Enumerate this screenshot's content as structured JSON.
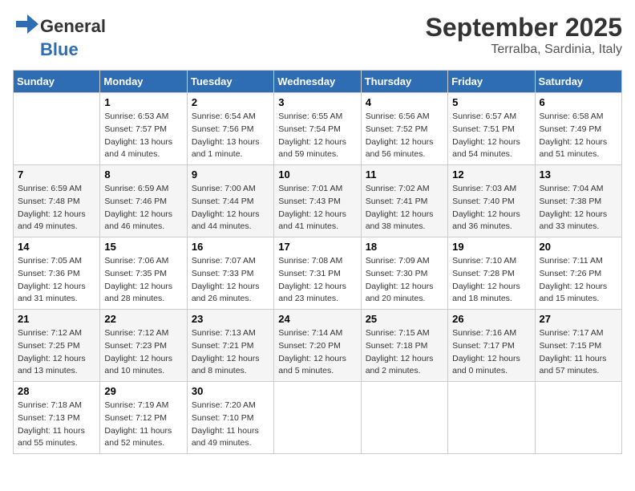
{
  "header": {
    "logo_general": "General",
    "logo_blue": "Blue",
    "month": "September 2025",
    "location": "Terralba, Sardinia, Italy"
  },
  "days_of_week": [
    "Sunday",
    "Monday",
    "Tuesday",
    "Wednesday",
    "Thursday",
    "Friday",
    "Saturday"
  ],
  "weeks": [
    [
      {
        "day": "",
        "sunrise": "",
        "sunset": "",
        "daylight": ""
      },
      {
        "day": "1",
        "sunrise": "Sunrise: 6:53 AM",
        "sunset": "Sunset: 7:57 PM",
        "daylight": "Daylight: 13 hours and 4 minutes."
      },
      {
        "day": "2",
        "sunrise": "Sunrise: 6:54 AM",
        "sunset": "Sunset: 7:56 PM",
        "daylight": "Daylight: 13 hours and 1 minute."
      },
      {
        "day": "3",
        "sunrise": "Sunrise: 6:55 AM",
        "sunset": "Sunset: 7:54 PM",
        "daylight": "Daylight: 12 hours and 59 minutes."
      },
      {
        "day": "4",
        "sunrise": "Sunrise: 6:56 AM",
        "sunset": "Sunset: 7:52 PM",
        "daylight": "Daylight: 12 hours and 56 minutes."
      },
      {
        "day": "5",
        "sunrise": "Sunrise: 6:57 AM",
        "sunset": "Sunset: 7:51 PM",
        "daylight": "Daylight: 12 hours and 54 minutes."
      },
      {
        "day": "6",
        "sunrise": "Sunrise: 6:58 AM",
        "sunset": "Sunset: 7:49 PM",
        "daylight": "Daylight: 12 hours and 51 minutes."
      }
    ],
    [
      {
        "day": "7",
        "sunrise": "Sunrise: 6:59 AM",
        "sunset": "Sunset: 7:48 PM",
        "daylight": "Daylight: 12 hours and 49 minutes."
      },
      {
        "day": "8",
        "sunrise": "Sunrise: 6:59 AM",
        "sunset": "Sunset: 7:46 PM",
        "daylight": "Daylight: 12 hours and 46 minutes."
      },
      {
        "day": "9",
        "sunrise": "Sunrise: 7:00 AM",
        "sunset": "Sunset: 7:44 PM",
        "daylight": "Daylight: 12 hours and 44 minutes."
      },
      {
        "day": "10",
        "sunrise": "Sunrise: 7:01 AM",
        "sunset": "Sunset: 7:43 PM",
        "daylight": "Daylight: 12 hours and 41 minutes."
      },
      {
        "day": "11",
        "sunrise": "Sunrise: 7:02 AM",
        "sunset": "Sunset: 7:41 PM",
        "daylight": "Daylight: 12 hours and 38 minutes."
      },
      {
        "day": "12",
        "sunrise": "Sunrise: 7:03 AM",
        "sunset": "Sunset: 7:40 PM",
        "daylight": "Daylight: 12 hours and 36 minutes."
      },
      {
        "day": "13",
        "sunrise": "Sunrise: 7:04 AM",
        "sunset": "Sunset: 7:38 PM",
        "daylight": "Daylight: 12 hours and 33 minutes."
      }
    ],
    [
      {
        "day": "14",
        "sunrise": "Sunrise: 7:05 AM",
        "sunset": "Sunset: 7:36 PM",
        "daylight": "Daylight: 12 hours and 31 minutes."
      },
      {
        "day": "15",
        "sunrise": "Sunrise: 7:06 AM",
        "sunset": "Sunset: 7:35 PM",
        "daylight": "Daylight: 12 hours and 28 minutes."
      },
      {
        "day": "16",
        "sunrise": "Sunrise: 7:07 AM",
        "sunset": "Sunset: 7:33 PM",
        "daylight": "Daylight: 12 hours and 26 minutes."
      },
      {
        "day": "17",
        "sunrise": "Sunrise: 7:08 AM",
        "sunset": "Sunset: 7:31 PM",
        "daylight": "Daylight: 12 hours and 23 minutes."
      },
      {
        "day": "18",
        "sunrise": "Sunrise: 7:09 AM",
        "sunset": "Sunset: 7:30 PM",
        "daylight": "Daylight: 12 hours and 20 minutes."
      },
      {
        "day": "19",
        "sunrise": "Sunrise: 7:10 AM",
        "sunset": "Sunset: 7:28 PM",
        "daylight": "Daylight: 12 hours and 18 minutes."
      },
      {
        "day": "20",
        "sunrise": "Sunrise: 7:11 AM",
        "sunset": "Sunset: 7:26 PM",
        "daylight": "Daylight: 12 hours and 15 minutes."
      }
    ],
    [
      {
        "day": "21",
        "sunrise": "Sunrise: 7:12 AM",
        "sunset": "Sunset: 7:25 PM",
        "daylight": "Daylight: 12 hours and 13 minutes."
      },
      {
        "day": "22",
        "sunrise": "Sunrise: 7:12 AM",
        "sunset": "Sunset: 7:23 PM",
        "daylight": "Daylight: 12 hours and 10 minutes."
      },
      {
        "day": "23",
        "sunrise": "Sunrise: 7:13 AM",
        "sunset": "Sunset: 7:21 PM",
        "daylight": "Daylight: 12 hours and 8 minutes."
      },
      {
        "day": "24",
        "sunrise": "Sunrise: 7:14 AM",
        "sunset": "Sunset: 7:20 PM",
        "daylight": "Daylight: 12 hours and 5 minutes."
      },
      {
        "day": "25",
        "sunrise": "Sunrise: 7:15 AM",
        "sunset": "Sunset: 7:18 PM",
        "daylight": "Daylight: 12 hours and 2 minutes."
      },
      {
        "day": "26",
        "sunrise": "Sunrise: 7:16 AM",
        "sunset": "Sunset: 7:17 PM",
        "daylight": "Daylight: 12 hours and 0 minutes."
      },
      {
        "day": "27",
        "sunrise": "Sunrise: 7:17 AM",
        "sunset": "Sunset: 7:15 PM",
        "daylight": "Daylight: 11 hours and 57 minutes."
      }
    ],
    [
      {
        "day": "28",
        "sunrise": "Sunrise: 7:18 AM",
        "sunset": "Sunset: 7:13 PM",
        "daylight": "Daylight: 11 hours and 55 minutes."
      },
      {
        "day": "29",
        "sunrise": "Sunrise: 7:19 AM",
        "sunset": "Sunset: 7:12 PM",
        "daylight": "Daylight: 11 hours and 52 minutes."
      },
      {
        "day": "30",
        "sunrise": "Sunrise: 7:20 AM",
        "sunset": "Sunset: 7:10 PM",
        "daylight": "Daylight: 11 hours and 49 minutes."
      },
      {
        "day": "",
        "sunrise": "",
        "sunset": "",
        "daylight": ""
      },
      {
        "day": "",
        "sunrise": "",
        "sunset": "",
        "daylight": ""
      },
      {
        "day": "",
        "sunrise": "",
        "sunset": "",
        "daylight": ""
      },
      {
        "day": "",
        "sunrise": "",
        "sunset": "",
        "daylight": ""
      }
    ]
  ]
}
